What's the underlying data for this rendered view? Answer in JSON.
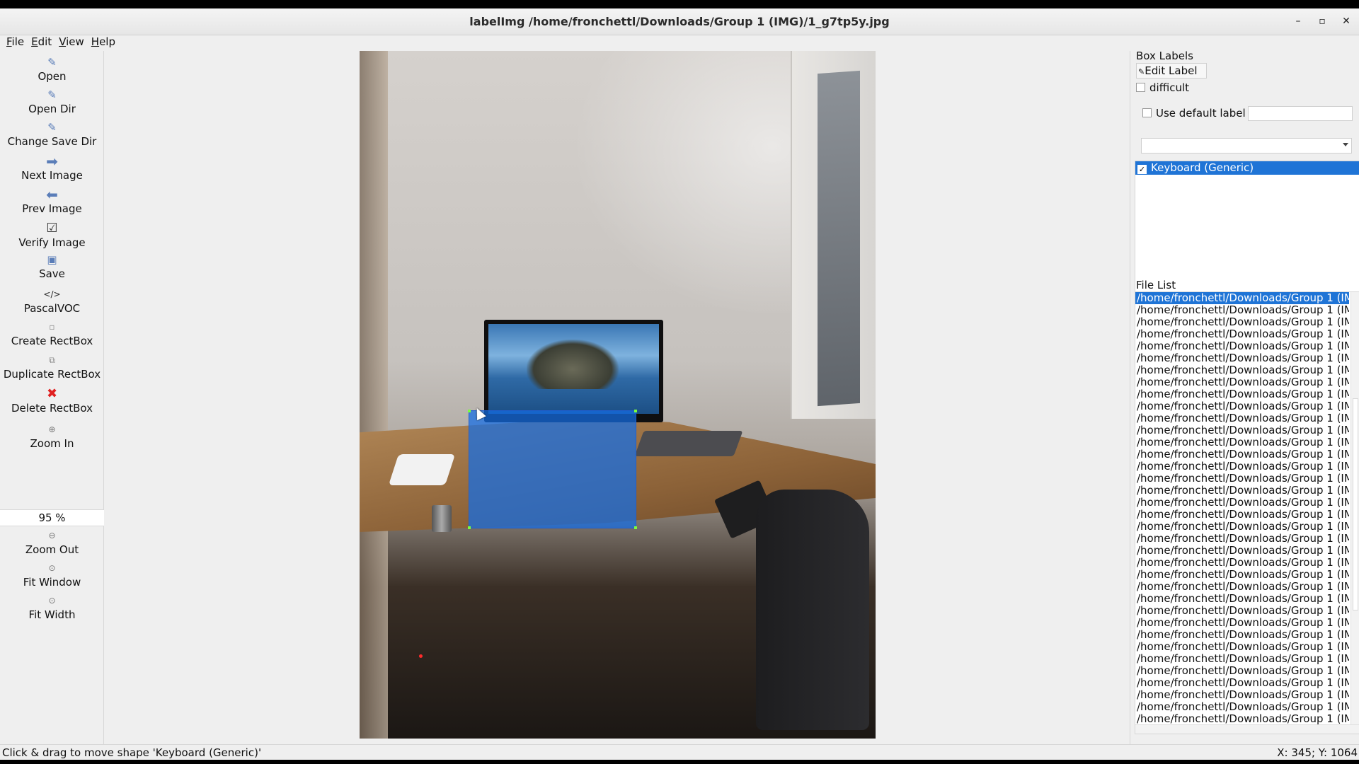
{
  "window": {
    "title": "labelImg /home/fronchettl/Downloads/Group 1 (IMG)/1_g7tp5y.jpg",
    "minimize": "–",
    "maximize": "▫",
    "close": "✕"
  },
  "menu": [
    "File",
    "Edit",
    "View",
    "Help"
  ],
  "toolbar": {
    "open": "Open",
    "open_dir": "Open Dir",
    "change_save_dir": "Change Save Dir",
    "next_image": "Next Image",
    "prev_image": "Prev Image",
    "verify_image": "Verify Image",
    "save": "Save",
    "format": "PascalVOC",
    "create_rectbox": "Create RectBox",
    "duplicate_rectbox": "Duplicate RectBox",
    "delete_rectbox": "Delete RectBox",
    "zoom_in": "Zoom In",
    "zoom_value": "95 %",
    "zoom_out": "Zoom Out",
    "fit_window": "Fit Window",
    "fit_width": "Fit Width",
    "format_icon": "</>"
  },
  "right_panel": {
    "box_labels_title": "Box Labels",
    "edit_label": "Edit Label",
    "difficult": "difficult",
    "use_default_label": "Use default label",
    "labels": [
      "Keyboard (Generic)"
    ],
    "file_list_title": "File List",
    "files": [
      "/home/fronchettl/Downloads/Group 1 (IMG",
      "/home/fronchettl/Downloads/Group 1 (IMG",
      "/home/fronchettl/Downloads/Group 1 (IMG",
      "/home/fronchettl/Downloads/Group 1 (IMG",
      "/home/fronchettl/Downloads/Group 1 (IMG",
      "/home/fronchettl/Downloads/Group 1 (IMG",
      "/home/fronchettl/Downloads/Group 1 (IMG",
      "/home/fronchettl/Downloads/Group 1 (IMG",
      "/home/fronchettl/Downloads/Group 1 (IMG",
      "/home/fronchettl/Downloads/Group 1 (IMG",
      "/home/fronchettl/Downloads/Group 1 (IMG",
      "/home/fronchettl/Downloads/Group 1 (IMG",
      "/home/fronchettl/Downloads/Group 1 (IMG",
      "/home/fronchettl/Downloads/Group 1 (IMG",
      "/home/fronchettl/Downloads/Group 1 (IMG",
      "/home/fronchettl/Downloads/Group 1 (IMG",
      "/home/fronchettl/Downloads/Group 1 (IMG",
      "/home/fronchettl/Downloads/Group 1 (IMG",
      "/home/fronchettl/Downloads/Group 1 (IMG",
      "/home/fronchettl/Downloads/Group 1 (IMG",
      "/home/fronchettl/Downloads/Group 1 (IMG",
      "/home/fronchettl/Downloads/Group 1 (IMG",
      "/home/fronchettl/Downloads/Group 1 (IMG",
      "/home/fronchettl/Downloads/Group 1 (IMG",
      "/home/fronchettl/Downloads/Group 1 (IMG",
      "/home/fronchettl/Downloads/Group 1 (IMG",
      "/home/fronchettl/Downloads/Group 1 (IMG",
      "/home/fronchettl/Downloads/Group 1 (IMG",
      "/home/fronchettl/Downloads/Group 1 (IMG",
      "/home/fronchettl/Downloads/Group 1 (IMG",
      "/home/fronchettl/Downloads/Group 1 (IMG",
      "/home/fronchettl/Downloads/Group 1 (IMG",
      "/home/fronchettl/Downloads/Group 1 (IMG",
      "/home/fronchettl/Downloads/Group 1 (IMG",
      "/home/fronchettl/Downloads/Group 1 (IMG",
      "/home/fronchettl/Downloads/Group 1 (IMG"
    ]
  },
  "status": {
    "message": "Click & drag to move shape 'Keyboard (Generic)'",
    "coords": "X: 345; Y: 1064"
  },
  "colors": {
    "selection": "#1f74d6",
    "bbox_fill": "#146ee6",
    "bbox_vertex": "#7cff3c"
  }
}
